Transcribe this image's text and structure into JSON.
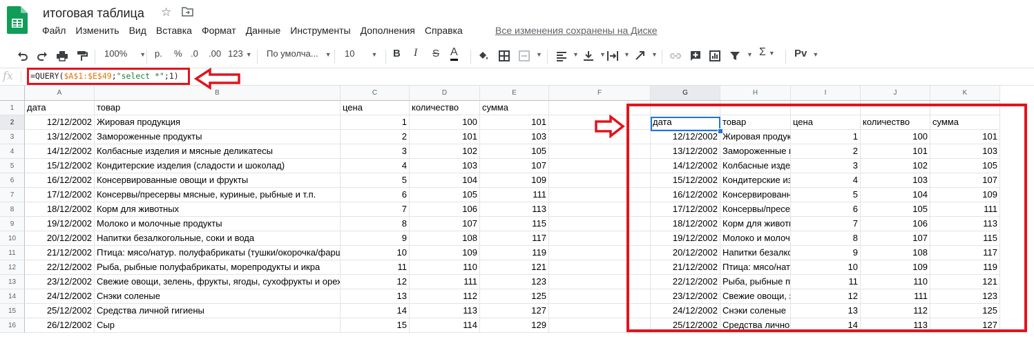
{
  "header": {
    "title": "итоговая таблица",
    "menus": [
      "Файл",
      "Изменить",
      "Вид",
      "Вставка",
      "Формат",
      "Данные",
      "Инструменты",
      "Дополнения",
      "Справка"
    ],
    "save_status": "Все изменения сохранены на Диске"
  },
  "toolbar": {
    "zoom": "100%",
    "currency": "р.",
    "percent": "%",
    "dec_decrease": ".0",
    "dec_increase": ".00",
    "more_formats": "123",
    "font": "По умолча...",
    "font_size": "10",
    "bold": "B",
    "italic": "I",
    "strike": "S",
    "text_color": "A",
    "input_tools": "Pv",
    "colors": {
      "text_color_bar": "#000000",
      "accent": "#1a73e8",
      "annotation": "#e0141e"
    }
  },
  "formula": {
    "prefix": "=QUERY(",
    "range": "$A$1:$E$49",
    "sep1": ";",
    "query": "\"select *\"",
    "suffix": ";1)"
  },
  "columns": [
    "A",
    "B",
    "C",
    "D",
    "E",
    "F",
    "G",
    "H",
    "I",
    "J",
    "K"
  ],
  "rows": [
    "1",
    "2",
    "3",
    "4",
    "5",
    "6",
    "7",
    "8",
    "9",
    "10",
    "11",
    "12",
    "13",
    "14",
    "15",
    "16"
  ],
  "left_table": {
    "headers": [
      "дата",
      "товар",
      "цена",
      "количество",
      "сумма"
    ],
    "data": [
      [
        "12/12/2002",
        "Жировая продукция",
        "1",
        "100",
        "101"
      ],
      [
        "13/12/2002",
        "Замороженные продукты",
        "2",
        "101",
        "103"
      ],
      [
        "14/12/2002",
        "Колбасные изделия и мясные деликатесы",
        "3",
        "102",
        "105"
      ],
      [
        "15/12/2002",
        "Кондитерские изделия (сладости и шоколад)",
        "4",
        "103",
        "107"
      ],
      [
        "16/12/2002",
        "Консервированные овощи и фрукты",
        "5",
        "104",
        "109"
      ],
      [
        "17/12/2002",
        "Консервы/пресервы мясные, куриные, рыбные и т.п.",
        "6",
        "105",
        "111"
      ],
      [
        "18/12/2002",
        "Корм для животных",
        "7",
        "106",
        "113"
      ],
      [
        "19/12/2002",
        "Молоко и молочные продукты",
        "8",
        "107",
        "115"
      ],
      [
        "20/12/2002",
        "Напитки безалкогольные, соки и вода",
        "9",
        "108",
        "117"
      ],
      [
        "21/12/2002",
        "Птица: мясо/натур. полуфабрикаты (тушки/окорочка/фарш",
        "10",
        "109",
        "119"
      ],
      [
        "22/12/2002",
        "Рыба, рыбные полуфабрикаты, морепродукты и икра",
        "11",
        "110",
        "121"
      ],
      [
        "23/12/2002",
        "Свежие овощи, зелень, фрукты, ягоды, сухофрукты и орех",
        "12",
        "111",
        "123"
      ],
      [
        "24/12/2002",
        "Снэки соленые",
        "13",
        "112",
        "125"
      ],
      [
        "25/12/2002",
        "Средства личной гигиены",
        "14",
        "113",
        "127"
      ],
      [
        "26/12/2002",
        "Сыр",
        "15",
        "114",
        "129"
      ]
    ]
  },
  "right_table": {
    "headers": [
      "дата",
      "товар",
      "цена",
      "количество",
      "сумма"
    ],
    "data": [
      [
        "12/12/2002",
        "Жировая продукция",
        "1",
        "100",
        "101"
      ],
      [
        "13/12/2002",
        "Замороженные продукты",
        "2",
        "101",
        "103"
      ],
      [
        "14/12/2002",
        "Колбасные изделия",
        "3",
        "102",
        "105"
      ],
      [
        "15/12/2002",
        "Кондитерские изделия",
        "4",
        "103",
        "107"
      ],
      [
        "16/12/2002",
        "Консервированные овощи",
        "5",
        "104",
        "109"
      ],
      [
        "17/12/2002",
        "Консервы/пресервы",
        "6",
        "105",
        "111"
      ],
      [
        "18/12/2002",
        "Корм для животных",
        "7",
        "106",
        "113"
      ],
      [
        "19/12/2002",
        "Молоко и молочные",
        "8",
        "107",
        "115"
      ],
      [
        "20/12/2002",
        "Напитки безалкогольные",
        "9",
        "108",
        "117"
      ],
      [
        "21/12/2002",
        "Птица: мясо/натур.",
        "10",
        "109",
        "119"
      ],
      [
        "22/12/2002",
        "Рыба, рыбные полуфабрикаты",
        "11",
        "110",
        "121"
      ],
      [
        "23/12/2002",
        "Свежие овощи, зелень",
        "12",
        "111",
        "123"
      ],
      [
        "24/12/2002",
        "Снэки соленые",
        "13",
        "112",
        "125"
      ],
      [
        "25/12/2002",
        "Средства личной гигиены",
        "14",
        "113",
        "127"
      ]
    ]
  }
}
